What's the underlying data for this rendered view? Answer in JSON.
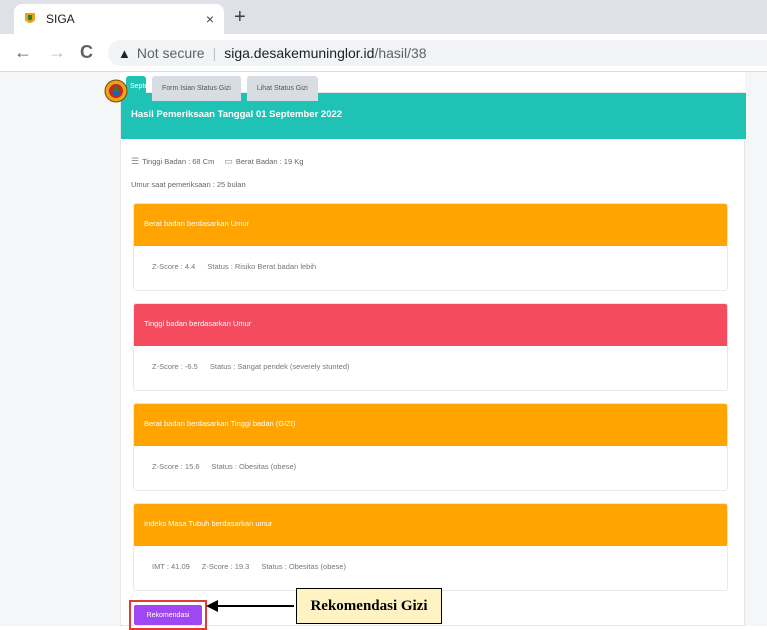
{
  "browser": {
    "tab_title": "SIGA",
    "close_glyph": "×",
    "new_tab_glyph": "+",
    "back_glyph": "←",
    "forward_glyph": "→",
    "reload_glyph": "C",
    "security_warning_glyph": "▲",
    "not_secure": "Not secure",
    "separator": "|",
    "url_host": "siga.desakemuninglor.id",
    "url_path": "/hasil/38"
  },
  "page": {
    "tabs": [
      {
        "label": "Septe"
      },
      {
        "label": "Form Isian Status Gizi"
      },
      {
        "label": "Lihat Status Gizi"
      }
    ],
    "header_title": "Hasil Pemeriksaan Tanggal 01 September 2022",
    "height_label": "Tinggi Badan : 68 Cm",
    "weight_label": "Berat Badan : 19 Kg",
    "age_label": "Umur saat pemeriksaan : 25 bulan",
    "results": [
      {
        "title": "Berat badan berdasarkan Umur",
        "color": "#ffa400",
        "items": [
          "Z-Score : 4.4",
          "Status : Risiko Berat badan lebih"
        ]
      },
      {
        "title": "Tinggi badan berdasarkan Umur",
        "color": "#f44b5e",
        "items": [
          "Z-Score : -6.5",
          "Status : Sangat pendek (severely stunted)"
        ]
      },
      {
        "title": "Berat badan berdasarkan Tinggi badan (GIZI)",
        "color": "#ffa400",
        "items": [
          "Z-Score : 15.6",
          "Status : Obesitas (obese)"
        ]
      },
      {
        "title": "Indeks Masa Tubuh berdasarkan umur",
        "color": "#ffa400",
        "items": [
          "IMT : 41.09",
          "Z-Score : 19.3",
          "Status : Obesitas (obese)"
        ]
      }
    ],
    "recommend_button": "Rekomendasi",
    "callout_label": "Rekomendasi Gizi"
  },
  "colors": {
    "header": "#1fc3b5",
    "orange": "#ffa400",
    "red": "#f44b5e",
    "button": "#9e47f3",
    "highlight": "#e53935"
  }
}
